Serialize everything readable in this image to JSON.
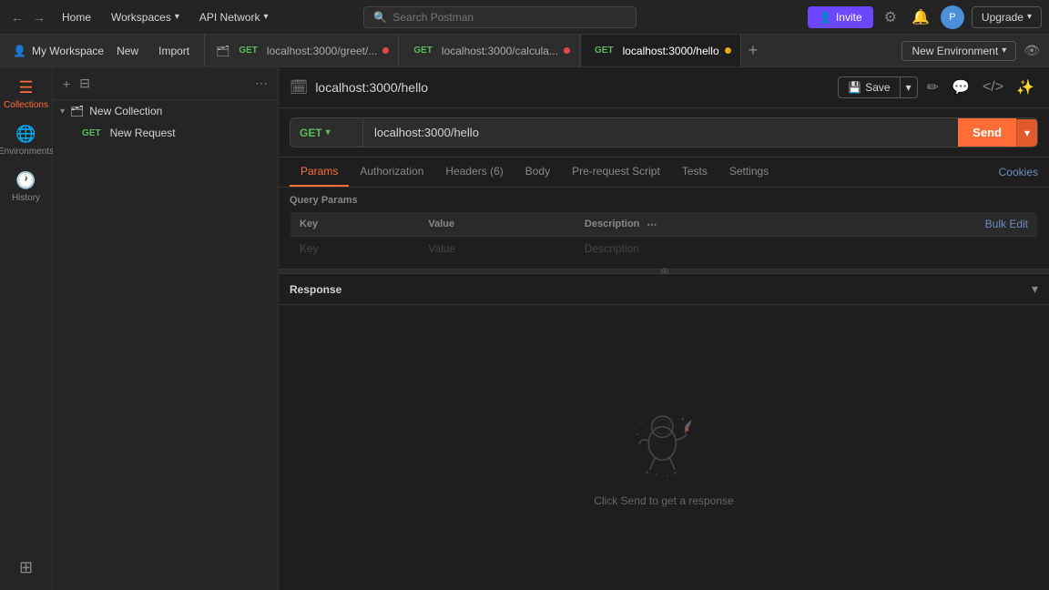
{
  "topBar": {
    "homeLabel": "Home",
    "workspacesLabel": "Workspaces",
    "apiNetworkLabel": "API Network",
    "searchPlaceholder": "Search Postman",
    "inviteLabel": "Invite",
    "upgradeLabel": "Upgrade"
  },
  "tabs": {
    "workspaceName": "My Workspace",
    "newLabel": "New",
    "importLabel": "Import",
    "items": [
      {
        "method": "GET",
        "url": "localhost:3000/greet/...",
        "dot": "red"
      },
      {
        "method": "GET",
        "url": "localhost:3000/calcula...",
        "dot": "red"
      },
      {
        "method": "GET",
        "url": "localhost:3000/hello",
        "dot": "orange",
        "active": true
      }
    ],
    "addTabLabel": "+",
    "envLabel": "New Environment"
  },
  "sidebar": {
    "collections": "Collections",
    "environments": "Environments",
    "history": "History",
    "apps": "Apps"
  },
  "collectionsPanel": {
    "newCollection": "New Collection",
    "newRequest": "New Request"
  },
  "request": {
    "icon": "🗓",
    "title": "localhost:3000/hello",
    "saveLabel": "Save",
    "method": "GET",
    "url": "localhost:3000/hello",
    "sendLabel": "Send"
  },
  "requestTabs": {
    "params": "Params",
    "authorization": "Authorization",
    "headers": "Headers (6)",
    "body": "Body",
    "preRequestScript": "Pre-request Script",
    "tests": "Tests",
    "settings": "Settings",
    "cookies": "Cookies"
  },
  "queryParams": {
    "title": "Query Params",
    "columns": [
      "Key",
      "Value",
      "Description"
    ],
    "bulkEdit": "Bulk Edit",
    "emptyRow": {
      "key": "Key",
      "value": "Value",
      "description": "Description"
    }
  },
  "response": {
    "title": "Response",
    "emptyText": "Click Send to get a response"
  }
}
